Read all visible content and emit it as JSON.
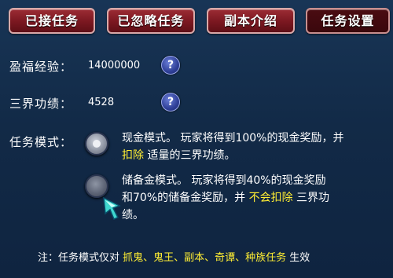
{
  "tabs": [
    {
      "label": "已接任务"
    },
    {
      "label": "已忽略任务"
    },
    {
      "label": "副本介绍"
    },
    {
      "label": "任务设置"
    }
  ],
  "yingfu": {
    "label": "盈福经验：",
    "value": "14000000"
  },
  "sanjie": {
    "label": "三界功绩：",
    "value": "4528"
  },
  "help_symbol": "?",
  "mode": {
    "label": "任务模式：",
    "cash": {
      "line1": "现金模式。  玩家将得到100%的现金奖励，并",
      "line2_highlight": "扣除",
      "line2_rest": " 适量的三界功绩。"
    },
    "reserve": {
      "line1": "储备金模式。 玩家将得到40%的现金奖励",
      "line2_prefix": "和70%的储备金奖励，并 ",
      "line2_highlight": "不会扣除",
      "line2_suffix": " 三界功",
      "line3": "绩。"
    }
  },
  "note": {
    "prefix": "注：任务模式仅对 ",
    "items": "抓鬼、鬼王、副本、奇谭、种族任务",
    "suffix": " 生效"
  },
  "colors": {
    "highlight": "#ffee33",
    "tab": "#7a1720",
    "background": "#142b48"
  }
}
